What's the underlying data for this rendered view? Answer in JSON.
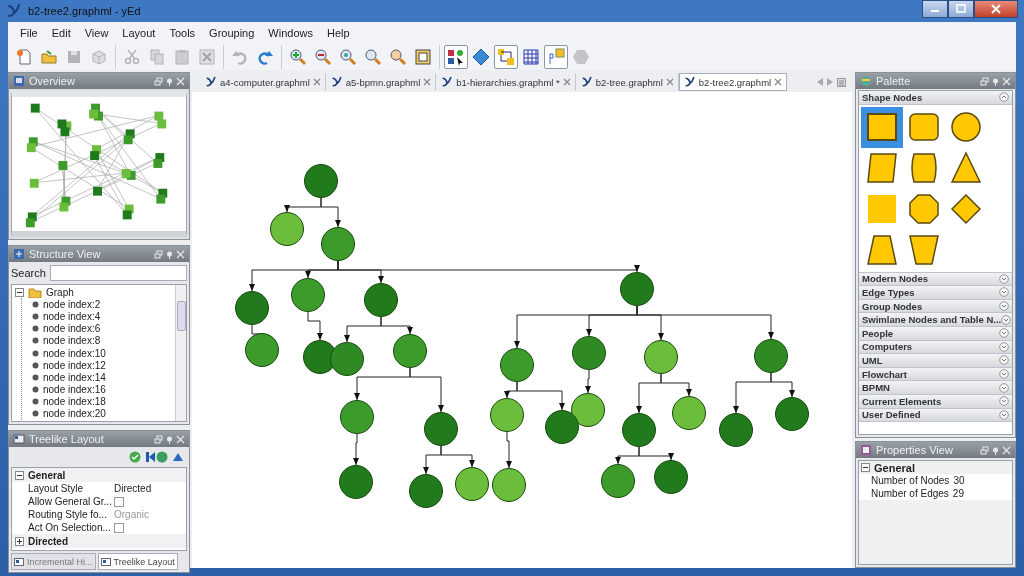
{
  "window": {
    "title": "b2-tree2.graphml - yEd"
  },
  "menu": [
    "File",
    "Edit",
    "View",
    "Layout",
    "Tools",
    "Grouping",
    "Windows",
    "Help"
  ],
  "toolbar": {
    "groups": [
      {
        "buttons": [
          {
            "kind": "new",
            "pressed": false,
            "disabled": false
          },
          {
            "kind": "open",
            "pressed": false,
            "disabled": false
          },
          {
            "kind": "save",
            "pressed": false,
            "disabled": true
          },
          {
            "kind": "cube",
            "pressed": false,
            "disabled": true
          }
        ]
      },
      {
        "buttons": [
          {
            "kind": "cut",
            "pressed": false,
            "disabled": true
          },
          {
            "kind": "copy",
            "pressed": false,
            "disabled": true
          },
          {
            "kind": "paste",
            "pressed": false,
            "disabled": true
          },
          {
            "kind": "delete",
            "pressed": false,
            "disabled": true
          }
        ]
      },
      {
        "buttons": [
          {
            "kind": "undo",
            "pressed": false,
            "disabled": true
          },
          {
            "kind": "redo",
            "pressed": false,
            "disabled": false
          }
        ]
      },
      {
        "buttons": [
          {
            "kind": "zoomin",
            "pressed": false,
            "disabled": false
          },
          {
            "kind": "zoomout",
            "pressed": false,
            "disabled": false
          },
          {
            "kind": "zoomreset",
            "pressed": false,
            "disabled": false
          },
          {
            "kind": "zoom",
            "pressed": false,
            "disabled": false
          },
          {
            "kind": "zoomarea",
            "pressed": false,
            "disabled": false
          },
          {
            "kind": "fit",
            "pressed": false,
            "disabled": false
          }
        ]
      },
      {
        "buttons": [
          {
            "kind": "edit",
            "pressed": true,
            "disabled": false
          },
          {
            "kind": "diamond",
            "pressed": false,
            "disabled": false
          },
          {
            "kind": "hierarchy",
            "pressed": true,
            "disabled": false
          },
          {
            "kind": "grid",
            "pressed": false,
            "disabled": false
          },
          {
            "kind": "port",
            "pressed": true,
            "disabled": false
          },
          {
            "kind": "hexagon",
            "pressed": false,
            "disabled": true
          }
        ]
      }
    ]
  },
  "overview": {
    "title": "Overview"
  },
  "structure_view": {
    "title": "Structure View",
    "search_label": "Search",
    "tree": [
      {
        "label": "Graph",
        "expanded": true,
        "children": [
          {
            "label": "node index:2"
          },
          {
            "label": "node index:4"
          },
          {
            "label": "node index:6"
          },
          {
            "label": "node index:8"
          },
          {
            "label": "node index:10"
          },
          {
            "label": "node index:12"
          },
          {
            "label": "node index:14"
          },
          {
            "label": "node index:16"
          },
          {
            "label": "node index:18"
          },
          {
            "label": "node index:20"
          }
        ]
      }
    ]
  },
  "layout_panel": {
    "title": "Treelike Layout",
    "sections": [
      {
        "label": "General",
        "expanded": true,
        "rows": [
          {
            "kind": "text",
            "label": "Layout Style",
            "value": "Directed",
            "disabled": false
          },
          {
            "kind": "checkbox",
            "label": "Allow General Gr...",
            "checked": false,
            "disabled": false
          },
          {
            "kind": "text",
            "label": "Routing Style fo...",
            "value": "Organic",
            "disabled": true
          },
          {
            "kind": "checkbox",
            "label": "Act On Selection...",
            "checked": false,
            "disabled": false
          }
        ]
      },
      {
        "label": "Directed",
        "expanded": false
      }
    ],
    "tabs": [
      {
        "label": "Incremental Hi...",
        "selected": false
      },
      {
        "label": "Treelike Layout",
        "selected": true
      }
    ]
  },
  "documents": {
    "tabs": [
      {
        "label": "a4-computer.graphml",
        "selected": false
      },
      {
        "label": "a5-bpmn.graphml",
        "selected": false
      },
      {
        "label": "b1-hierarchies.graphml *",
        "selected": false
      },
      {
        "label": "b2-tree.graphml",
        "selected": false
      },
      {
        "label": "b2-tree2.graphml",
        "selected": true
      }
    ]
  },
  "palette": {
    "title": "Palette",
    "sections": [
      {
        "label": "Shape Nodes",
        "expanded": true,
        "shapes": [
          {
            "kind": "rectangle",
            "selected": true
          },
          {
            "kind": "roundrect",
            "selected": false
          },
          {
            "kind": "ellipse",
            "selected": false
          },
          {
            "kind": "parallelogram",
            "selected": false
          },
          {
            "kind": "hexagon",
            "selected": false
          },
          {
            "kind": "triangle",
            "selected": false
          },
          {
            "kind": "plain",
            "selected": false
          },
          {
            "kind": "octagon",
            "selected": false
          },
          {
            "kind": "diamond",
            "selected": false
          },
          {
            "kind": "trapezoid",
            "selected": false
          },
          {
            "kind": "trapezoid2",
            "selected": false
          }
        ]
      },
      {
        "label": "Modern Nodes",
        "expanded": false
      },
      {
        "label": "Edge Types",
        "expanded": false
      },
      {
        "label": "Group Nodes",
        "expanded": false
      },
      {
        "label": "Swimlane Nodes and Table N...",
        "expanded": false
      },
      {
        "label": "People",
        "expanded": false
      },
      {
        "label": "Computers",
        "expanded": false
      },
      {
        "label": "UML",
        "expanded": false
      },
      {
        "label": "Flowchart",
        "expanded": false
      },
      {
        "label": "BPMN",
        "expanded": false
      },
      {
        "label": "Current Elements",
        "expanded": false
      },
      {
        "label": "User Defined",
        "expanded": false
      }
    ]
  },
  "properties": {
    "title": "Properties View",
    "sections": [
      {
        "label": "General",
        "expanded": true,
        "rows": [
          {
            "label": "Number of Nodes",
            "value": "30"
          },
          {
            "label": "Number of Edges",
            "value": "29"
          }
        ]
      }
    ]
  }
}
